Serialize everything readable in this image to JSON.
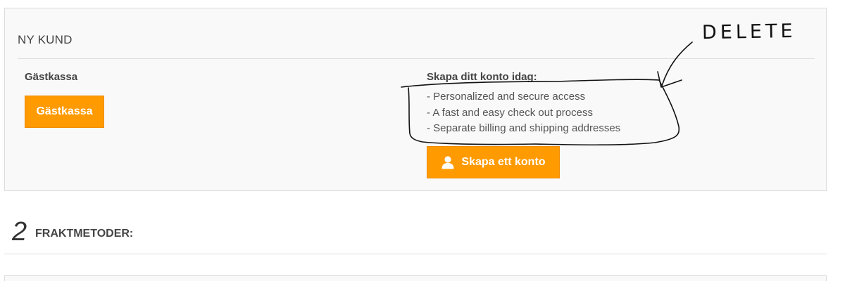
{
  "new_customer": {
    "title": "NY KUND",
    "guest": {
      "title": "Gästkassa",
      "button_label": "Gästkassa"
    },
    "create_account": {
      "title": "Skapa ditt konto idag:",
      "benefits": [
        "- Personalized and secure access",
        "- A fast and easy check out process",
        "- Separate billing and shipping addresses"
      ],
      "button_label": "Skapa ett konto",
      "button_icon": "user-icon"
    }
  },
  "annotation": {
    "text": "DELETE"
  },
  "shipping_step": {
    "number": "2",
    "title": "FRAKTMETODER:"
  },
  "colors": {
    "accent": "#ff9a00",
    "panel_bg": "#f9f9f9",
    "border": "#dcdcdc"
  }
}
